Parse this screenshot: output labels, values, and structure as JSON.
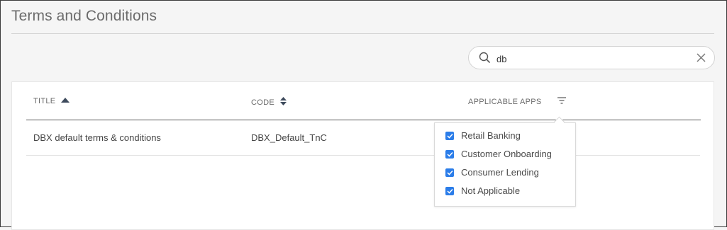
{
  "page": {
    "title": "Terms and Conditions"
  },
  "search": {
    "value": "db",
    "placeholder": ""
  },
  "table": {
    "columns": {
      "title": "TITLE",
      "code": "CODE",
      "apps": "APPLICABLE APPS"
    },
    "rows": [
      {
        "title": "DBX default terms & conditions",
        "code": "DBX_Default_TnC"
      }
    ]
  },
  "filter_menu": {
    "options": [
      {
        "label": "Retail Banking",
        "checked": true
      },
      {
        "label": "Customer Onboarding",
        "checked": true
      },
      {
        "label": "Consumer Lending",
        "checked": true
      },
      {
        "label": "Not Applicable",
        "checked": true
      }
    ]
  },
  "colors": {
    "accent": "#2b7de9",
    "sort_icon": "#3d4a5c"
  },
  "icons": {
    "search": "search-icon",
    "clear": "close-icon",
    "sort_asc": "sort-ascending-icon",
    "sort_both": "sort-icon",
    "filter": "filter-icon",
    "check": "check-icon"
  }
}
